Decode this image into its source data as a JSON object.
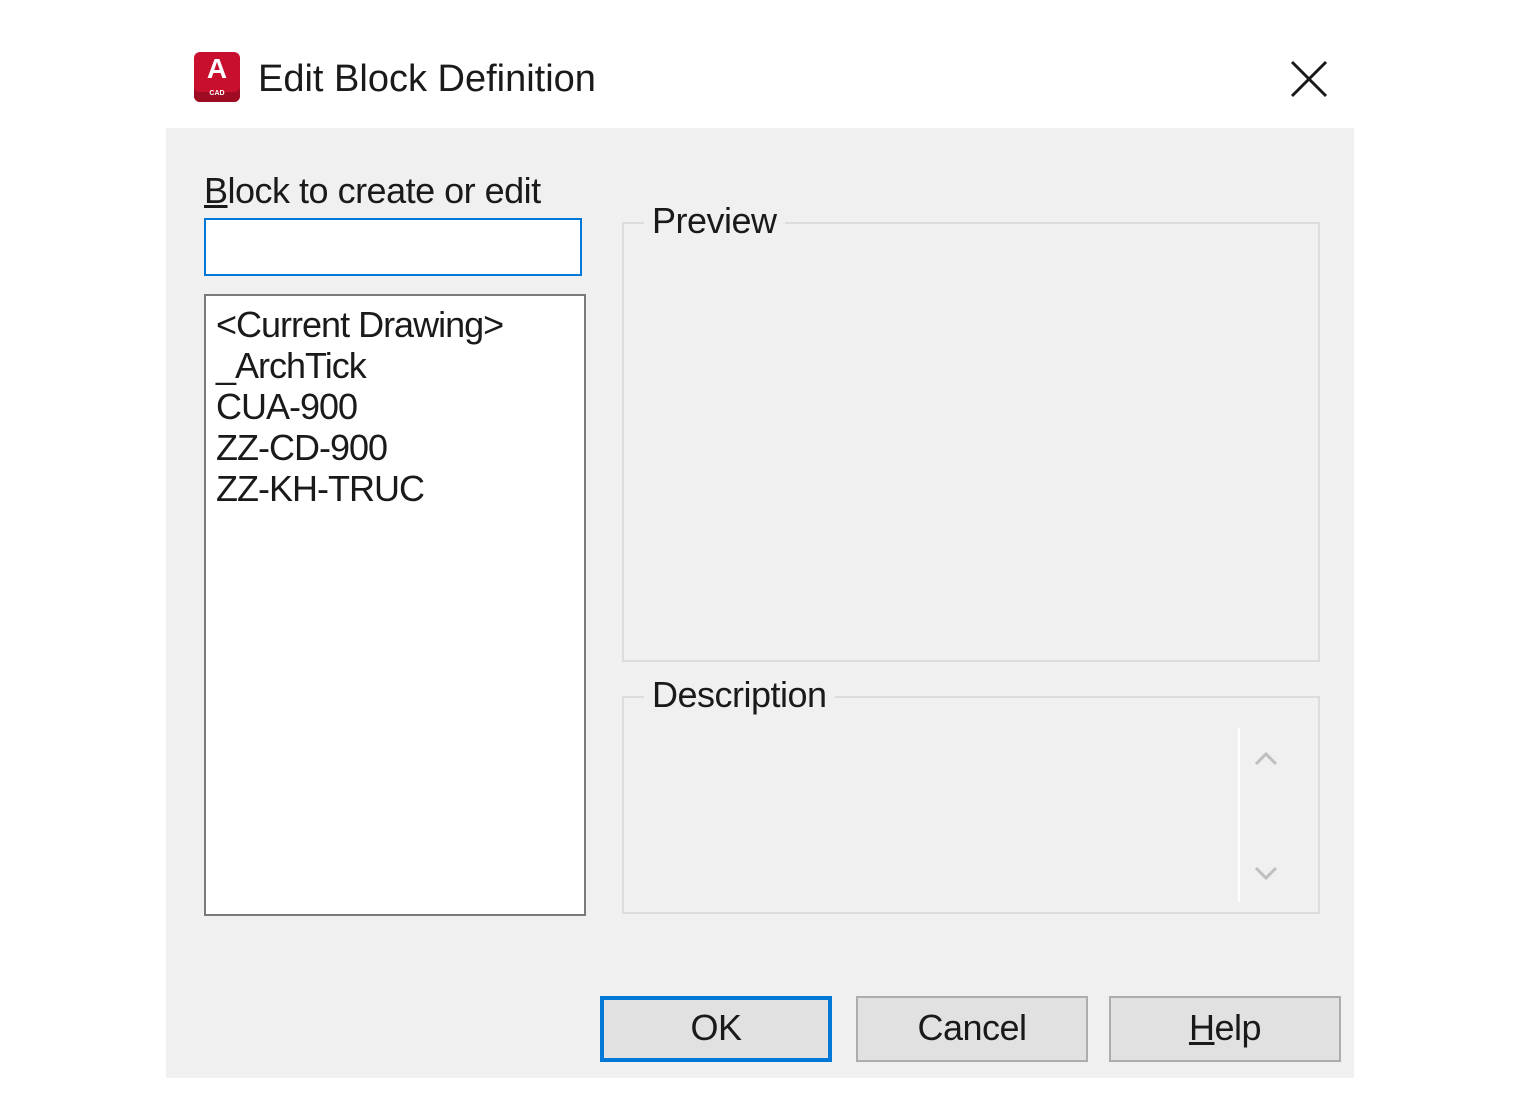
{
  "window": {
    "title": "Edit Block Definition",
    "icon": "autocad-app-icon",
    "icon_letter": "A",
    "icon_subtext": "CAD",
    "close_icon": "close-icon"
  },
  "block_field": {
    "label_first": "B",
    "label_rest": "lock to create or edit",
    "value": ""
  },
  "block_list": {
    "items": [
      "<Current Drawing>",
      "_ArchTick",
      "CUA-900",
      "ZZ-CD-900",
      "ZZ-KH-TRUC"
    ]
  },
  "preview": {
    "label": "Preview"
  },
  "description": {
    "label": "Description",
    "value": ""
  },
  "buttons": {
    "ok": "OK",
    "cancel": "Cancel",
    "help_first": "H",
    "help_rest": "elp"
  },
  "colors": {
    "accent": "#0078d7",
    "dialog_bg": "#f0f0f0",
    "app_icon": "#c8102e"
  }
}
